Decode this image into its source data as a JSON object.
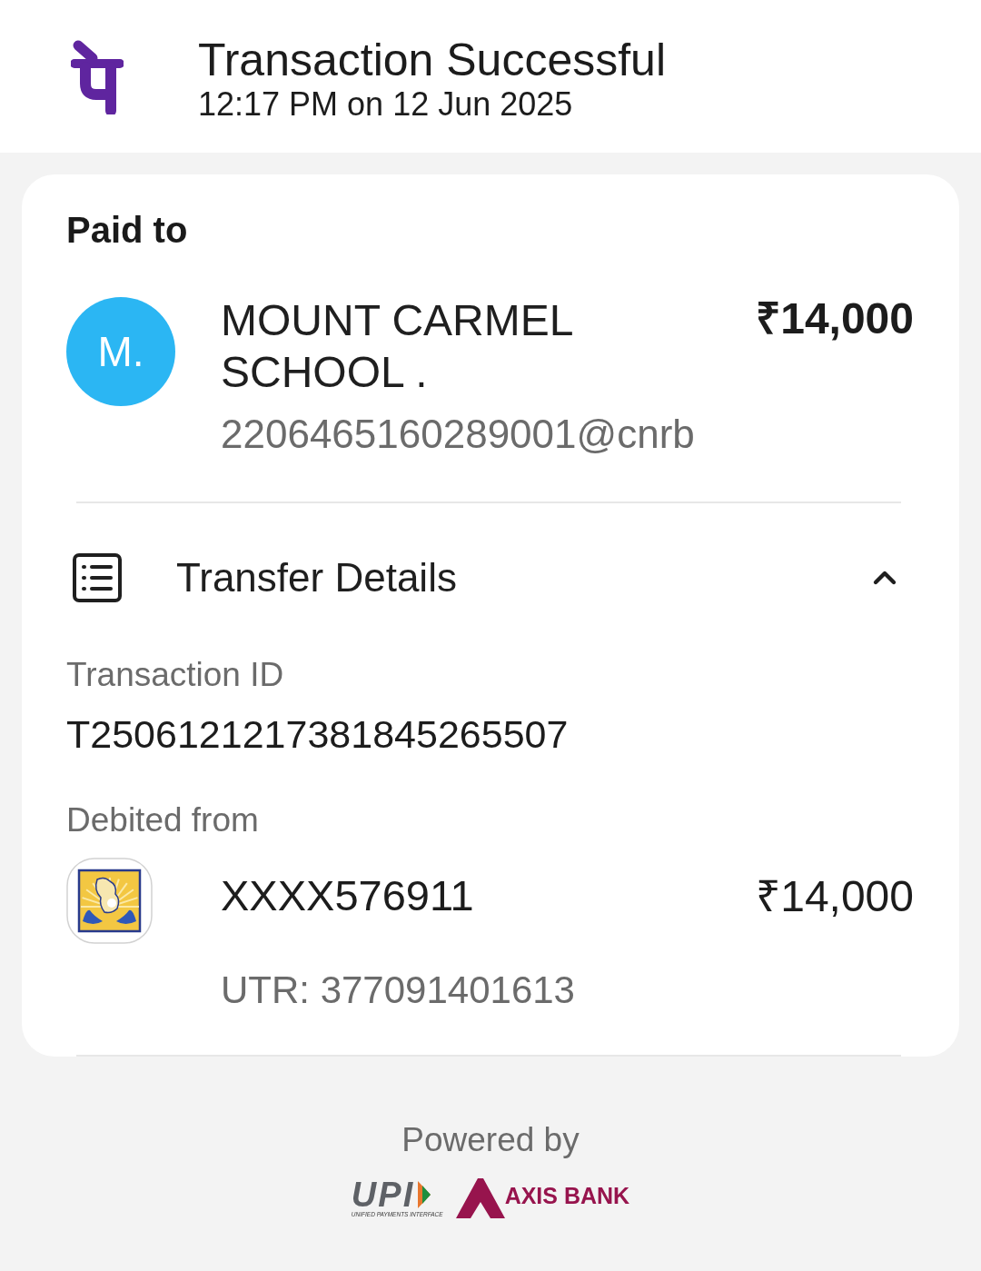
{
  "header": {
    "title": "Transaction Successful",
    "timestamp": "12:17 PM on 12 Jun 2025"
  },
  "paid_to": {
    "heading": "Paid to",
    "avatar": "M.",
    "name": "MOUNT CARMEL SCHOOL .",
    "upi_id": "2206465160289001@cnrb",
    "amount": "₹14,000"
  },
  "transfer_details": {
    "title": "Transfer Details",
    "expanded": true,
    "fields": [
      {
        "label": "Transaction ID",
        "value": "T2506121217381845265507"
      }
    ],
    "debited_from": {
      "label": "Debited from",
      "account": "XXXX576911",
      "amount": "₹14,000",
      "utr": "UTR: 377091401613"
    }
  },
  "footer": {
    "powered_by": "Powered by",
    "logos": [
      {
        "kind": "upi",
        "wordmark": "UPI",
        "tagline": "UNIFIED PAYMENTS INTERFACE"
      },
      {
        "kind": "bank",
        "wordmark": "AXIS BANK"
      }
    ]
  }
}
